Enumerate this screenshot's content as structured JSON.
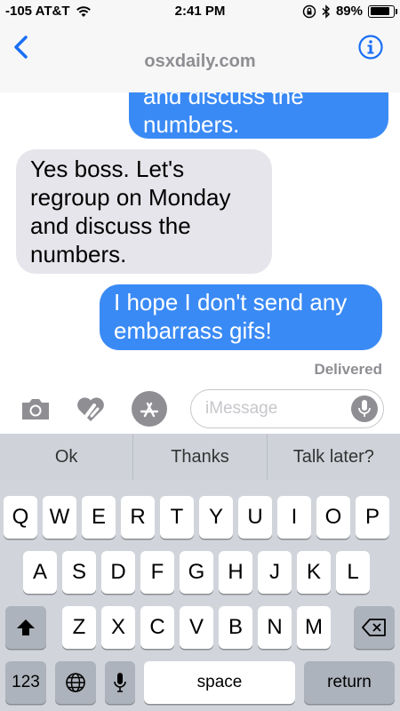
{
  "status_bar": {
    "carrier": "-105 AT&T",
    "time": "2:41 PM",
    "battery": "89%",
    "battery_level": 0.89,
    "icons": [
      "wifi-icon",
      "rotation-lock-icon",
      "bluetooth-icon",
      "battery-icon"
    ]
  },
  "header": {
    "contact": "osxdaily.com",
    "back_icon": "chevron-left-icon",
    "info_icon": "info-icon",
    "accent": "#1a6ef5"
  },
  "messages": [
    {
      "direction": "sent",
      "text": "and discuss the numbers."
    },
    {
      "direction": "received",
      "text": "Yes boss. Let's regroup on Monday and discuss the numbers."
    },
    {
      "direction": "sent",
      "text": "I hope I don't send any embarrass gifs!"
    }
  ],
  "delivered_label": "Delivered",
  "input_bar": {
    "placeholder": "iMessage",
    "buttons": [
      "camera-icon",
      "digital-touch-heart-icon",
      "app-store-icon"
    ],
    "mic_icon": "microphone-icon"
  },
  "predictive": [
    "Ok",
    "Thanks",
    "Talk later?"
  ],
  "keyboard": {
    "row1": [
      "Q",
      "W",
      "E",
      "R",
      "T",
      "Y",
      "U",
      "I",
      "O",
      "P"
    ],
    "row2": [
      "A",
      "S",
      "D",
      "F",
      "G",
      "H",
      "J",
      "K",
      "L"
    ],
    "row3": [
      "Z",
      "X",
      "C",
      "V",
      "B",
      "N",
      "M"
    ],
    "numbers_key": "123",
    "space_key": "space",
    "return_key": "return"
  },
  "colors": {
    "sent_bubble": "#3a8af5",
    "received_bubble": "#e6e5eb",
    "keyboard_bg": "#d1d5db"
  }
}
